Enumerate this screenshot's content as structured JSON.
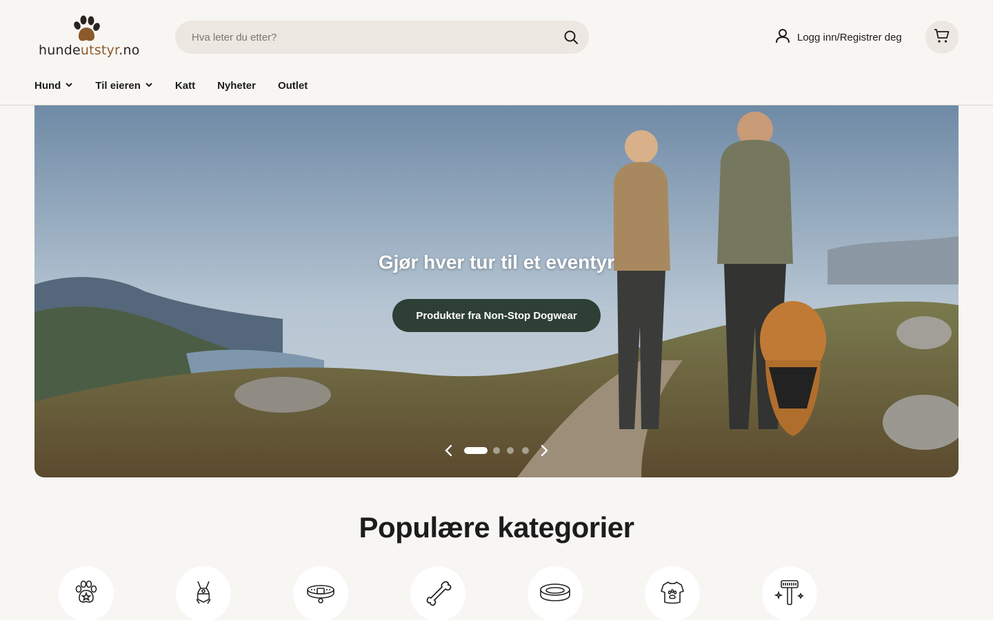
{
  "header": {
    "logo": {
      "text_main": "hunde",
      "text_accent": "utstyr",
      "text_tail": ".no"
    },
    "search": {
      "placeholder": "Hva leter du etter?",
      "value": ""
    },
    "account_label": "Logg inn/Registrer deg",
    "icons": {
      "search": "search-icon",
      "account": "user-icon",
      "cart": "cart-icon"
    }
  },
  "nav": {
    "items": [
      {
        "label": "Hund",
        "has_dropdown": true
      },
      {
        "label": "Til eieren",
        "has_dropdown": true
      },
      {
        "label": "Katt",
        "has_dropdown": false
      },
      {
        "label": "Nyheter",
        "has_dropdown": false
      },
      {
        "label": "Outlet",
        "has_dropdown": false
      }
    ]
  },
  "hero": {
    "title": "Gjør hver tur til et eventyr",
    "button_label": "Produkter fra Non-Stop Dogwear",
    "slides_count": 4,
    "active_slide": 1,
    "button_color": "#2e3f36"
  },
  "categories": {
    "title": "Populære kategorier",
    "items": [
      {
        "icon": "paw-star-icon"
      },
      {
        "icon": "harness-icon"
      },
      {
        "icon": "collar-icon"
      },
      {
        "icon": "bone-icon"
      },
      {
        "icon": "dog-bed-icon"
      },
      {
        "icon": "dog-sweater-icon"
      },
      {
        "icon": "grooming-brush-icon"
      }
    ]
  },
  "colors": {
    "background": "#f8f6f3",
    "search_bg": "#ece7e0",
    "logo_accent": "#8b5a2b"
  }
}
